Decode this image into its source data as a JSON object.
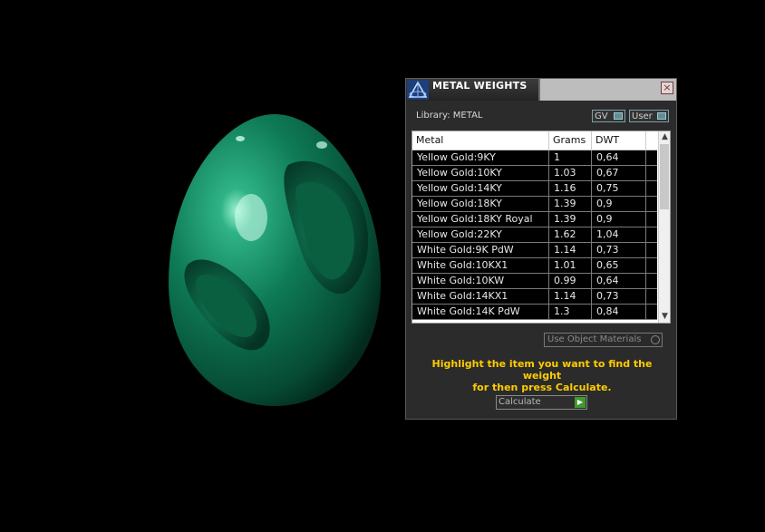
{
  "panel": {
    "title": "METAL WEIGHTS",
    "close_icon": "close-icon",
    "library_label": "Library: METAL",
    "toggles": {
      "gv": "GV",
      "user": "User"
    },
    "columns": [
      "Metal",
      "Grams",
      "DWT"
    ],
    "rows": [
      {
        "metal": "Yellow Gold:9KY",
        "grams": "1",
        "dwt": "0,64"
      },
      {
        "metal": "Yellow Gold:10KY",
        "grams": "1.03",
        "dwt": "0,67"
      },
      {
        "metal": "Yellow Gold:14KY",
        "grams": "1.16",
        "dwt": "0,75"
      },
      {
        "metal": "Yellow Gold:18KY",
        "grams": "1.39",
        "dwt": "0,9"
      },
      {
        "metal": "Yellow Gold:18KY Royal",
        "grams": "1.39",
        "dwt": "0,9"
      },
      {
        "metal": "Yellow Gold:22KY",
        "grams": "1.62",
        "dwt": "1,04"
      },
      {
        "metal": "White Gold:9K PdW",
        "grams": "1.14",
        "dwt": "0,73"
      },
      {
        "metal": "White Gold:10KX1",
        "grams": "1.01",
        "dwt": "0,65"
      },
      {
        "metal": "White Gold:10KW",
        "grams": "0.99",
        "dwt": "0,64"
      },
      {
        "metal": "White Gold:14KX1",
        "grams": "1.14",
        "dwt": "0,73"
      },
      {
        "metal": "White Gold:14K PdW",
        "grams": "1.3",
        "dwt": "0,84"
      }
    ],
    "use_object_materials": "Use Object Materials",
    "instruction_line1": "Highlight the item you want to find the weight",
    "instruction_line2": "for then press Calculate.",
    "calculate_label": "Calculate"
  },
  "colors": {
    "background": "#000000",
    "model_green": "#0b7a52",
    "instruction_text": "#ffcc00",
    "go_button": "#3f9a2c"
  }
}
